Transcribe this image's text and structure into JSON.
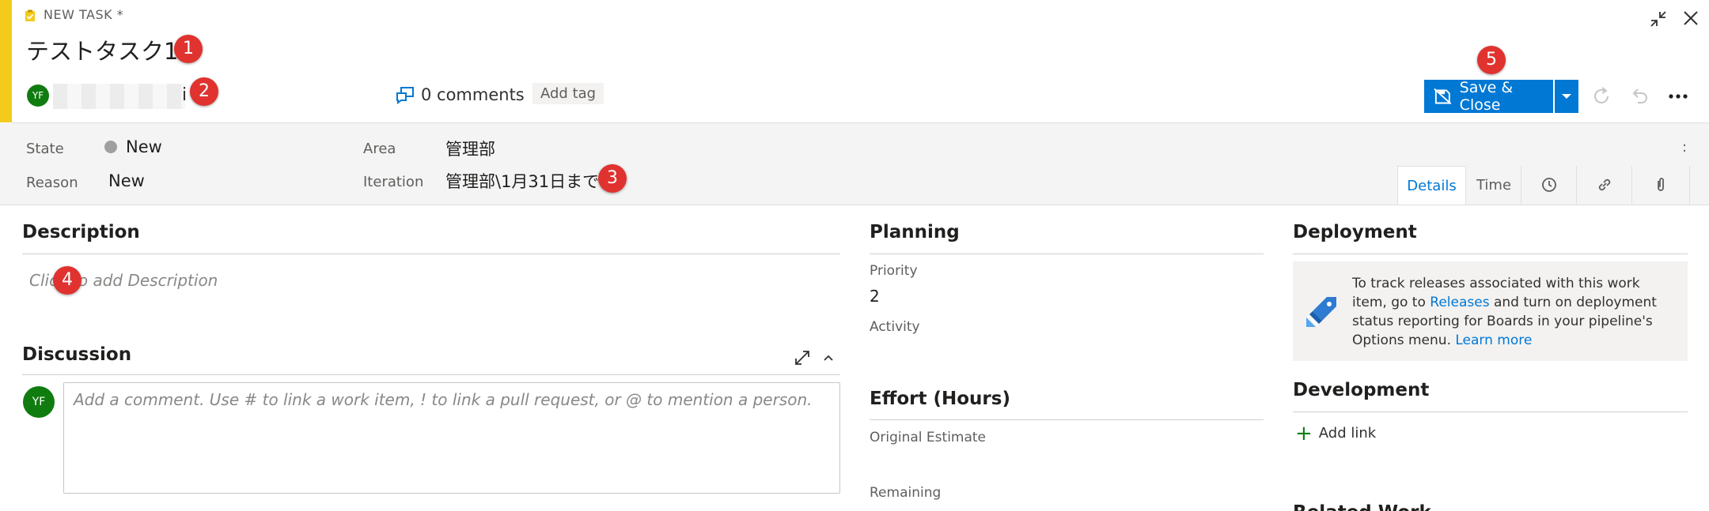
{
  "header": {
    "type_label": "NEW TASK *",
    "title": "テストタスク1",
    "assignee_initials": "YF",
    "assignee_tail": "i",
    "comments": "0 comments",
    "add_tag": "Add tag",
    "save_close": "Save & Close"
  },
  "fields": {
    "state_label": "State",
    "state_value": "New",
    "reason_label": "Reason",
    "reason_value": "New",
    "area_label": "Area",
    "area_value": "管理部",
    "iteration_label": "Iteration",
    "iteration_value": "管理部\\1月31日まで",
    "overflow": ":"
  },
  "tabs": {
    "details": "Details",
    "time": "Time"
  },
  "description": {
    "title": "Description",
    "placeholder": "Click to add Description"
  },
  "discussion": {
    "title": "Discussion",
    "avatar_initials": "YF",
    "placeholder": "Add a comment. Use # to link a work item, ! to link a pull request, or @ to mention a person."
  },
  "planning": {
    "title": "Planning",
    "priority_label": "Priority",
    "priority_value": "2",
    "activity_label": "Activity"
  },
  "effort": {
    "title": "Effort (Hours)",
    "original_label": "Original Estimate",
    "remaining_label": "Remaining"
  },
  "deployment": {
    "title": "Deployment",
    "text_1": "To track releases associated with this work item, go to",
    "releases_link": "Releases",
    "text_2": "and turn on deployment status reporting for Boards in your pipeline's Options menu.",
    "learn_more": "Learn more"
  },
  "development": {
    "title": "Development",
    "add_link": "Add link"
  },
  "related": {
    "title_partial": "Related Work"
  },
  "callouts": [
    "1",
    "2",
    "3",
    "4",
    "5"
  ],
  "colors": {
    "accent": "#f2cb1d",
    "primary": "#0078d4",
    "avatar": "#107c10",
    "callout": "#e0322f"
  }
}
